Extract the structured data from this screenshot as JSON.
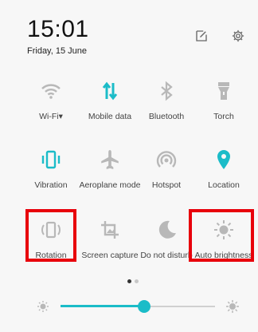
{
  "header": {
    "time": "15:01",
    "date": "Friday, 15 June",
    "edit_icon": "edit-icon",
    "settings_icon": "gear-icon"
  },
  "tiles": [
    {
      "label": "Wi-Fi▾",
      "icon": "wifi-icon",
      "active": false
    },
    {
      "label": "Mobile data",
      "icon": "mobile-data-icon",
      "active": true
    },
    {
      "label": "Bluetooth",
      "icon": "bluetooth-icon",
      "active": false
    },
    {
      "label": "Torch",
      "icon": "torch-icon",
      "active": false
    },
    {
      "label": "Vibration",
      "icon": "vibration-icon",
      "active": true
    },
    {
      "label": "Aeroplane mode",
      "icon": "airplane-icon",
      "active": false
    },
    {
      "label": "Hotspot",
      "icon": "hotspot-icon",
      "active": false
    },
    {
      "label": "Location",
      "icon": "location-icon",
      "active": true
    },
    {
      "label": "Rotation",
      "icon": "rotation-icon",
      "active": false
    },
    {
      "label": "Screen capture",
      "icon": "screen-capture-icon",
      "active": false
    },
    {
      "label": "Do not disturb",
      "icon": "moon-icon",
      "active": false
    },
    {
      "label": "Auto brightness",
      "icon": "brightness-icon",
      "active": false
    }
  ],
  "pager": {
    "current_page": 1,
    "total_pages": 2
  },
  "brightness": {
    "level": 0.54
  },
  "colors": {
    "accent": "#1bbcc8",
    "inactive_icon": "#b8b8b8",
    "highlight": "#e8000b",
    "background": "#f7f7f7"
  }
}
